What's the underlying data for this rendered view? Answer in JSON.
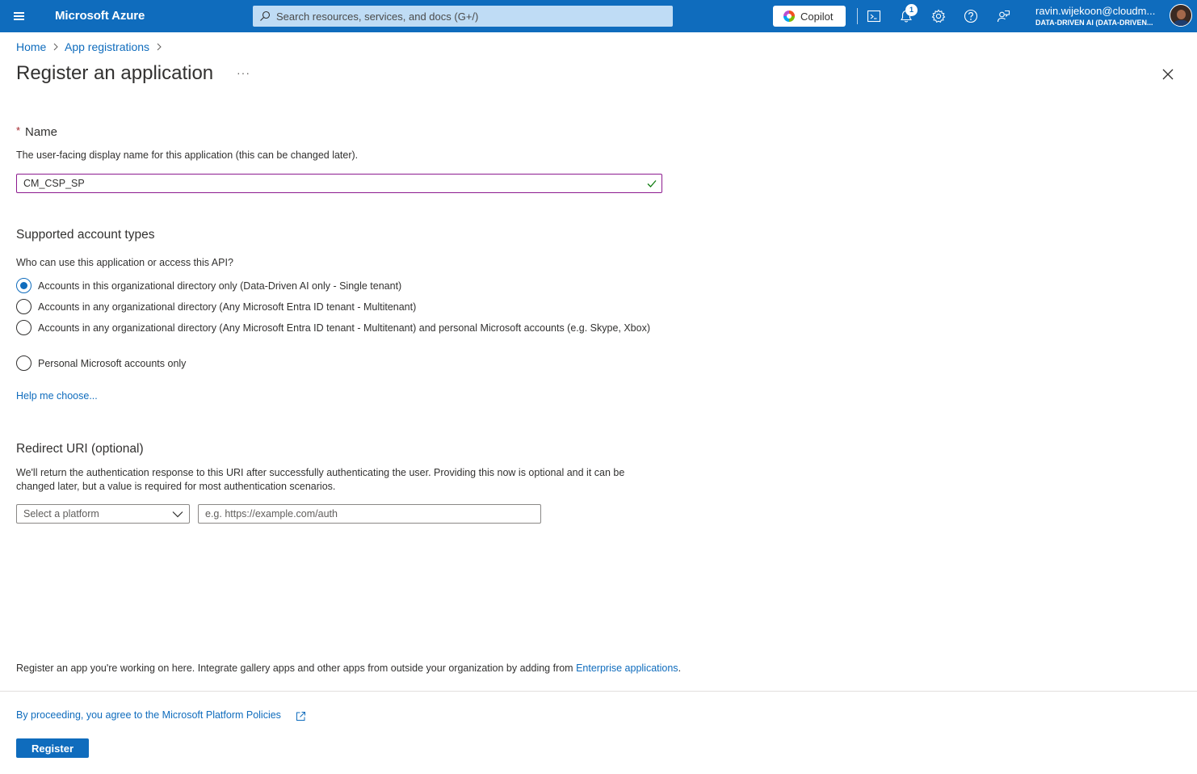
{
  "topbar": {
    "brand": "Microsoft Azure",
    "search_placeholder": "Search resources, services, and docs (G+/)",
    "copilot_label": "Copilot",
    "notification_count": "1",
    "account_user": "ravin.wijekoon@cloudm...",
    "account_tenant": "DATA-DRIVEN AI (DATA-DRIVEN...",
    "icons": [
      "menu-icon",
      "search-icon",
      "copilot-icon",
      "cloud-shell-icon",
      "bell-icon",
      "gear-icon",
      "help-icon",
      "feedback-icon"
    ]
  },
  "breadcrumb": {
    "items": [
      "Home",
      "App registrations"
    ]
  },
  "page": {
    "title": "Register an application",
    "more": "···"
  },
  "name_section": {
    "required_mark": "*",
    "label": "Name",
    "description": "The user-facing display name for this application (this can be changed later).",
    "value": "CM_CSP_SP"
  },
  "account_types": {
    "title": "Supported account types",
    "question": "Who can use this application or access this API?",
    "options": [
      "Accounts in this organizational directory only (Data-Driven AI only - Single tenant)",
      "Accounts in any organizational directory (Any Microsoft Entra ID tenant - Multitenant)",
      "Accounts in any organizational directory (Any Microsoft Entra ID tenant - Multitenant) and personal Microsoft accounts (e.g. Skype, Xbox)",
      "Personal Microsoft accounts only"
    ],
    "selected_index": 0,
    "help_link": "Help me choose..."
  },
  "redirect": {
    "title": "Redirect URI (optional)",
    "description": "We'll return the authentication response to this URI after successfully authenticating the user. Providing this now is optional and it can be changed later, but a value is required for most authentication scenarios.",
    "platform_placeholder": "Select a platform",
    "uri_placeholder": "e.g. https://example.com/auth"
  },
  "footer": {
    "note": "Register an app you're working on here. Integrate gallery apps and other apps from outside your organization by adding from",
    "note_link": "Enterprise applications",
    "note_end": ".",
    "policy_link": "By proceeding, you agree to the Microsoft Platform Policies",
    "register_label": "Register"
  },
  "colors": {
    "azure_blue": "#0f6cbd",
    "required_red": "#a4262c",
    "input_focus": "#8d1b8f",
    "success_green": "#107c10"
  }
}
